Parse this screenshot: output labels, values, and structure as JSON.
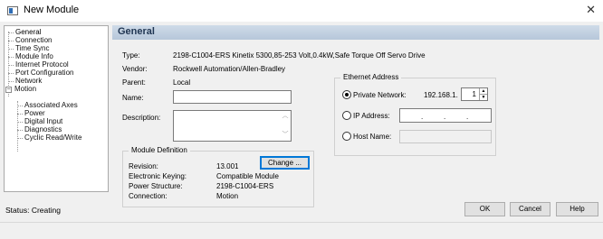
{
  "window": {
    "title": "New Module",
    "close_glyph": "✕"
  },
  "tree": {
    "items": [
      {
        "label": "General",
        "selected": true
      },
      {
        "label": "Connection"
      },
      {
        "label": "Time Sync"
      },
      {
        "label": "Module Info"
      },
      {
        "label": "Internet Protocol"
      },
      {
        "label": "Port Configuration"
      },
      {
        "label": "Network"
      },
      {
        "label": "Motion",
        "expander": "−"
      },
      {
        "label": "Associated Axes"
      },
      {
        "label": "Power"
      },
      {
        "label": "Digital Input"
      },
      {
        "label": "Diagnostics"
      },
      {
        "label": "Cyclic Read/Write"
      }
    ]
  },
  "panel": {
    "header": "General",
    "type_label": "Type:",
    "type_value": "2198-C1004-ERS Kinetix 5300,85-253 Volt,0.4kW,Safe Torque Off Servo Drive",
    "vendor_label": "Vendor:",
    "vendor_value": "Rockwell Automation/Allen-Bradley",
    "parent_label": "Parent:",
    "parent_value": "Local",
    "name_label": "Name:",
    "name_value": "",
    "description_label": "Description:",
    "description_value": ""
  },
  "module_definition": {
    "title": "Module Definition",
    "revision_label": "Revision:",
    "revision_value": "13.001",
    "keying_label": "Electronic Keying:",
    "keying_value": "Compatible Module",
    "power_label": "Power Structure:",
    "power_value": "2198-C1004-ERS",
    "connection_label": "Connection:",
    "connection_value": "Motion",
    "change_button": "Change ..."
  },
  "ethernet": {
    "title": "Ethernet Address",
    "private_label": "Private Network:",
    "private_prefix": "192.168.1.",
    "private_value": "1",
    "ip_label": "IP Address:",
    "ip_dots": [
      ".",
      ".",
      "."
    ],
    "host_label": "Host Name:",
    "selected": "private"
  },
  "footer": {
    "status": "Status: Creating",
    "ok": "OK",
    "cancel": "Cancel",
    "help": "Help"
  },
  "colors": {
    "header_bg": "#c3d1e2",
    "header_text": "#1f3552",
    "focus": "#0078d7"
  }
}
